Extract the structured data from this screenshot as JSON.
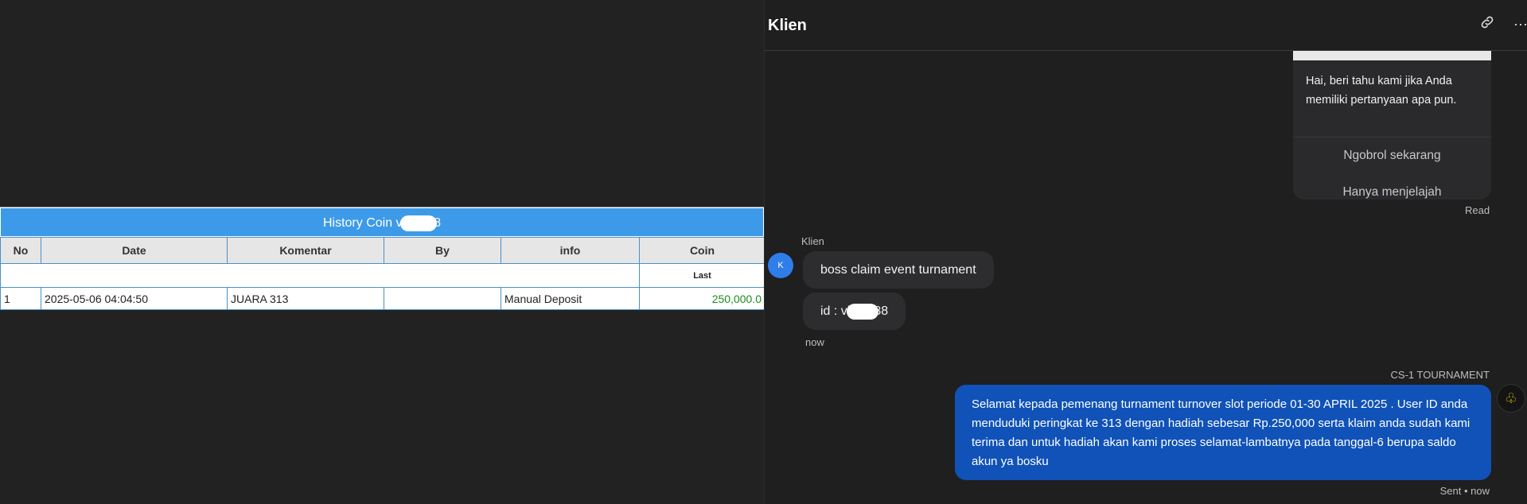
{
  "history": {
    "title_prefix": "History Coin vi",
    "title_suffix": "8",
    "columns": [
      "No",
      "Date",
      "Komentar",
      "By",
      "info",
      "Coin"
    ],
    "last_label": "Last",
    "rows": [
      {
        "no": "1",
        "date": "2025-05-06 04:04:50",
        "komentar": "JUARA 313",
        "by": "",
        "info": "Manual Deposit",
        "coin": "250,000.0"
      }
    ]
  },
  "chat": {
    "title": "Klien",
    "icons": {
      "link": "link-icon",
      "more": "more-icon"
    },
    "welcome_card": {
      "text": "Hai, beri tahu kami jika Anda memiliki pertanyaan apa pun.",
      "btn_chat": "Ngobrol sekarang",
      "btn_browse": "Hanya menjelajah"
    },
    "read_label": "Read",
    "sender_name": "Klien",
    "avatar_initial": "K",
    "msg1": "boss claim event turnament",
    "msg2_prefix": "id : vi",
    "msg2_suffix": "88",
    "time_in": "now",
    "agent_name": "CS-1 TOURNAMENT",
    "reply": "Selamat kepada pemenang turnament turnover slot periode 01-30 APRIL 2025 . User ID anda menduduki peringkat ke 313 dengan hadiah sebesar Rp.250,000 serta klaim anda sudah kami terima dan untuk hadiah akan kami proses selamat-lambatnya pada tanggal-6 berupa saldo akun ya bosku",
    "sent_label": "Sent • now"
  },
  "colors": {
    "table_header": "#3d9ae8",
    "bubble_out": "#1052b8",
    "avatar": "#2e7de9",
    "coin_amount": "#1e8a1e"
  }
}
